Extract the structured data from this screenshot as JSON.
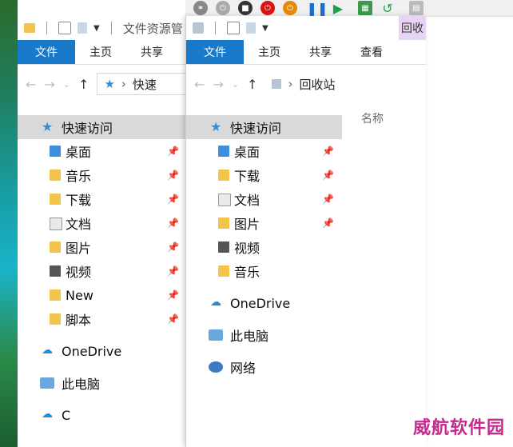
{
  "window1": {
    "title": "文件资源管",
    "ribbon_tabs": [
      "文件",
      "主页",
      "共享"
    ],
    "address": "快速",
    "tree_header": "快速访问",
    "items": [
      "桌面",
      "音乐",
      "下载",
      "文档",
      "图片",
      "视频",
      "New",
      "脚本"
    ],
    "groups": [
      "OneDrive",
      "此电脑",
      "C"
    ]
  },
  "window2": {
    "title_tab": "回收",
    "ribbon_tabs": [
      "文件",
      "主页",
      "共享",
      "查看"
    ],
    "address": "回收站",
    "column_header": "名称",
    "tree_header": "快速访问",
    "items": [
      "桌面",
      "下载",
      "文档",
      "图片",
      "视频",
      "音乐"
    ],
    "groups": [
      "OneDrive",
      "此电脑",
      "网络"
    ]
  },
  "watermark": "威航软件园"
}
